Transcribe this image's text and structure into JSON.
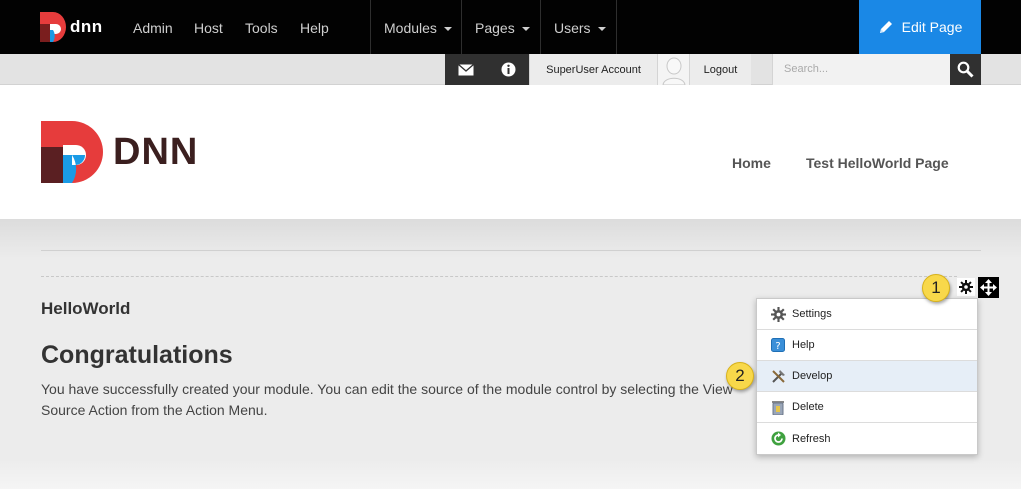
{
  "topbar": {
    "brand": "dnn",
    "links": [
      "Admin",
      "Host",
      "Tools",
      "Help"
    ],
    "menus": [
      "Modules",
      "Pages",
      "Users"
    ],
    "edit_page": "Edit Page"
  },
  "subbar": {
    "account": "SuperUser Account",
    "logout": "Logout",
    "search_placeholder": "Search..."
  },
  "header": {
    "logo_text": "DNN",
    "nav": [
      "Home",
      "Test HelloWorld Page"
    ]
  },
  "content": {
    "module_title": "HelloWorld",
    "heading": "Congratulations",
    "body": "You have successfully created your module. You can edit the source of the module control by selecting the View Source Action from the Action Menu."
  },
  "action_menu": {
    "items": [
      {
        "label": "Settings",
        "icon": "gear-icon"
      },
      {
        "label": "Help",
        "icon": "help-icon"
      },
      {
        "label": "Develop",
        "icon": "develop-tools-icon"
      },
      {
        "label": "Delete",
        "icon": "trash-icon"
      },
      {
        "label": "Refresh",
        "icon": "refresh-icon"
      }
    ],
    "highlighted_index": 2
  },
  "callouts": [
    "1",
    "2"
  ],
  "colors": {
    "accent": "#1a88e6",
    "callout": "#f8d84a"
  }
}
